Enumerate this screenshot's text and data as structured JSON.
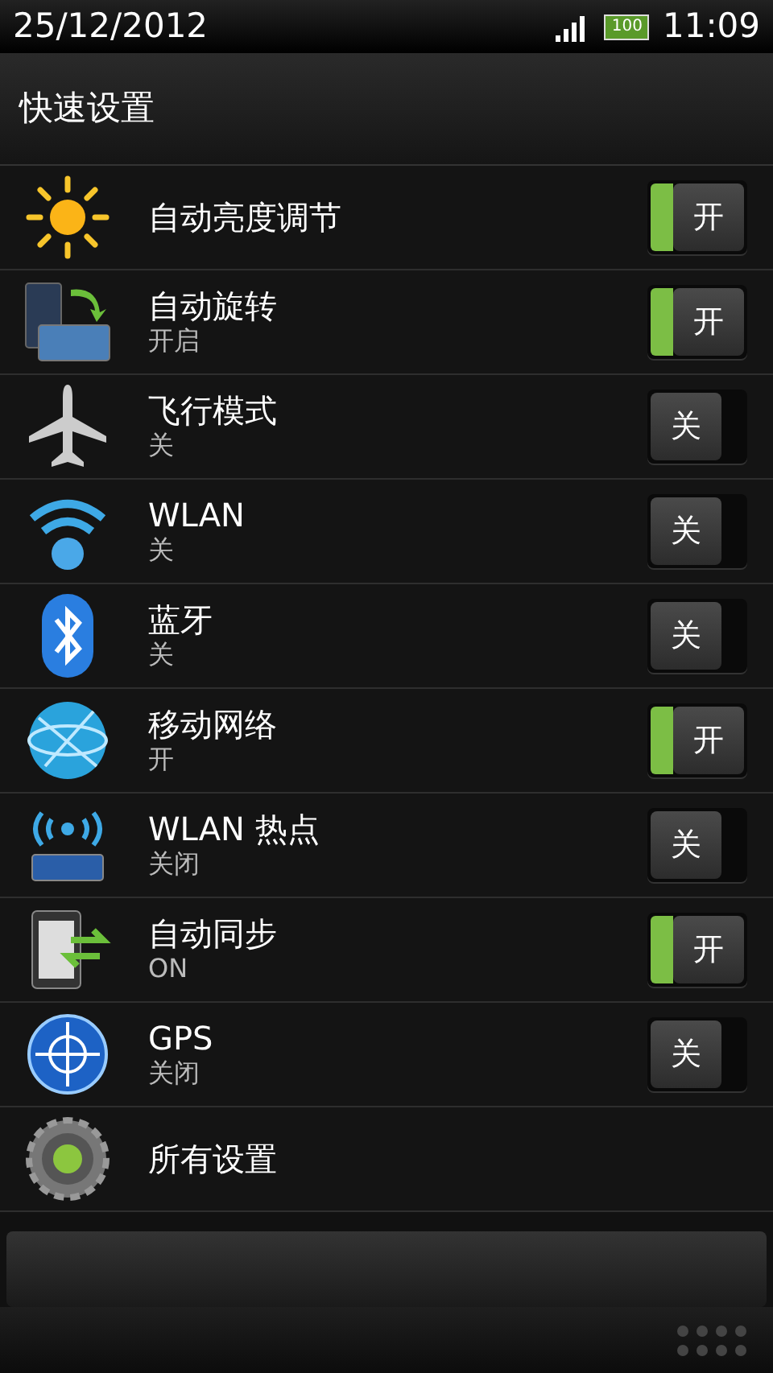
{
  "status_bar": {
    "date": "25/12/2012",
    "battery": "100",
    "time": "11:09"
  },
  "title": "快速设置",
  "items": [
    {
      "kind": "toggle",
      "label": "自动亮度调节",
      "on": true,
      "switch_label": "开"
    },
    {
      "kind": "toggle",
      "label": "自动旋转",
      "subtitle": "开启",
      "on": true,
      "switch_label": "开"
    },
    {
      "kind": "toggle",
      "label": "飞行模式",
      "subtitle": "关",
      "on": false,
      "switch_label": "关"
    },
    {
      "kind": "toggle",
      "label": "WLAN",
      "subtitle": "关",
      "on": false,
      "switch_label": "关"
    },
    {
      "kind": "toggle",
      "label": "蓝牙",
      "subtitle": "关",
      "on": false,
      "switch_label": "关"
    },
    {
      "kind": "toggle",
      "label": "移动网络",
      "subtitle": "开",
      "on": true,
      "switch_label": "开"
    },
    {
      "kind": "toggle",
      "label": "WLAN 热点",
      "subtitle": "关闭",
      "on": false,
      "switch_label": "关"
    },
    {
      "kind": "toggle",
      "label": "自动同步",
      "subtitle": "ON",
      "on": true,
      "switch_label": "开"
    },
    {
      "kind": "toggle",
      "label": "GPS",
      "subtitle": "关闭",
      "on": false,
      "switch_label": "关"
    },
    {
      "kind": "link",
      "label": "所有设置"
    }
  ]
}
